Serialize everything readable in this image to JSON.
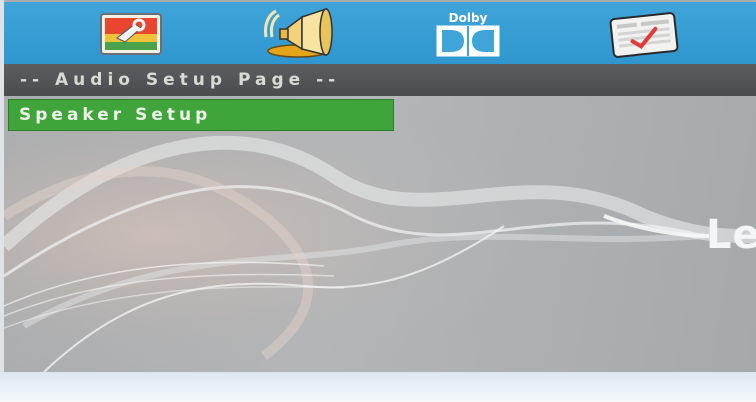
{
  "topbar": {
    "tabs": [
      {
        "icon": "general-setup-icon"
      },
      {
        "icon": "audio-speaker-icon"
      },
      {
        "icon": "dolby-digital-icon",
        "label": "Dolby"
      },
      {
        "icon": "preference-setup-icon"
      }
    ]
  },
  "page": {
    "title": "-- Audio Setup Page --"
  },
  "menu": {
    "items": [
      {
        "label": "Speaker Setup",
        "selected": true
      }
    ]
  },
  "background": {
    "brand_text": "Le"
  },
  "colors": {
    "topbar": "#3fa5d9",
    "titlebar": "#4f5154",
    "selected_item": "#3fa43a",
    "content": "#abaeb0"
  }
}
